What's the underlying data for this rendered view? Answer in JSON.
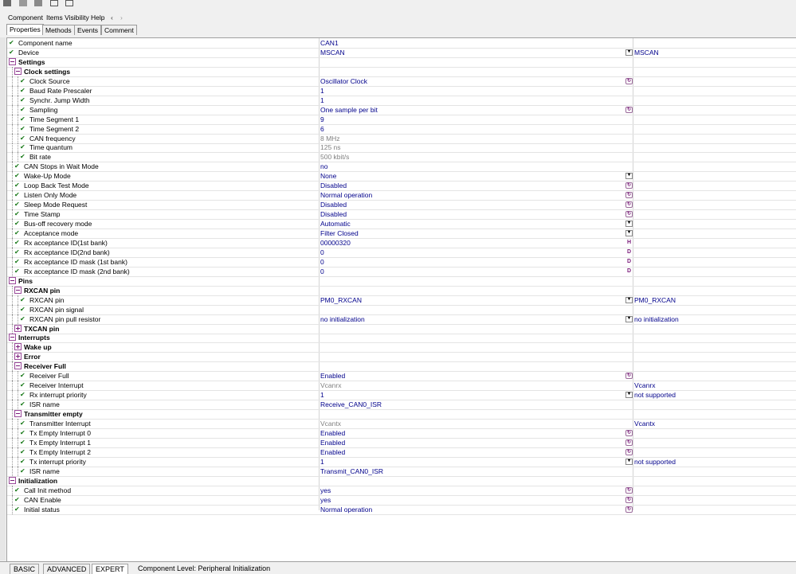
{
  "toolbar": {
    "icons": [
      "save-icon",
      "paste-icon",
      "gray-box-icon",
      "table-icon",
      "grid-icon"
    ]
  },
  "menu": {
    "component": "Component",
    "items_visibility": "Items Visibility",
    "help": "Help",
    "back": "‹",
    "forward": "›"
  },
  "tabs": [
    "Properties",
    "Methods",
    "Events",
    "Comment"
  ],
  "rows": [
    {
      "ind": 0,
      "chk": true,
      "name": "Component name",
      "val": "CAN1"
    },
    {
      "ind": 0,
      "chk": true,
      "name": "Device",
      "val": "MSCAN",
      "ctl": "dd",
      "val2": "MSCAN"
    },
    {
      "ind": 0,
      "box": "minus",
      "name": "Settings",
      "bold": true
    },
    {
      "ind": 1,
      "box": "minus",
      "name": "Clock settings",
      "bold": true
    },
    {
      "ind": 2,
      "chk": true,
      "name": "Clock Source",
      "val": "Oscillator Clock",
      "ctl": "reset"
    },
    {
      "ind": 2,
      "chk": true,
      "name": "Baud Rate Prescaler",
      "val": "1"
    },
    {
      "ind": 2,
      "chk": true,
      "name": "Synchr. Jump Width",
      "val": "1"
    },
    {
      "ind": 2,
      "chk": true,
      "name": "Sampling",
      "val": "One sample per bit",
      "ctl": "reset"
    },
    {
      "ind": 2,
      "chk": true,
      "name": "Time Segment 1",
      "val": "9"
    },
    {
      "ind": 2,
      "chk": true,
      "name": "Time Segment 2",
      "val": "6"
    },
    {
      "ind": 2,
      "chk": true,
      "name": "CAN frequency",
      "val": "8 MHz",
      "gray": true
    },
    {
      "ind": 2,
      "chk": true,
      "name": "Time quantum",
      "val": "125 ns",
      "gray": true
    },
    {
      "ind": 2,
      "chk": true,
      "name": "Bit rate",
      "val": "500 kbit/s",
      "gray": true
    },
    {
      "ind": 1,
      "chk": true,
      "name": "CAN Stops in Wait Mode",
      "val": "no"
    },
    {
      "ind": 1,
      "chk": true,
      "name": "Wake-Up Mode",
      "val": "None",
      "ctl": "dd"
    },
    {
      "ind": 1,
      "chk": true,
      "name": "Loop Back Test Mode",
      "val": "Disabled",
      "ctl": "reset"
    },
    {
      "ind": 1,
      "chk": true,
      "name": "Listen Only Mode",
      "val": "Normal operation",
      "ctl": "reset"
    },
    {
      "ind": 1,
      "chk": true,
      "name": "Sleep Mode Request",
      "val": "Disabled",
      "ctl": "reset"
    },
    {
      "ind": 1,
      "chk": true,
      "name": "Time Stamp",
      "val": "Disabled",
      "ctl": "reset"
    },
    {
      "ind": 1,
      "chk": true,
      "name": "Bus-off recovery mode",
      "val": "Automatic",
      "ctl": "dd"
    },
    {
      "ind": 1,
      "chk": true,
      "name": "Acceptance mode",
      "val": "Filter Closed",
      "ctl": "dd"
    },
    {
      "ind": 1,
      "chk": true,
      "name": "Rx acceptance ID(1st bank)",
      "val": "00000320",
      "ctl": "hex",
      "ctlText": "H"
    },
    {
      "ind": 1,
      "chk": true,
      "name": "Rx acceptance ID(2nd bank)",
      "val": "0",
      "ctl": "hex",
      "ctlText": "D"
    },
    {
      "ind": 1,
      "chk": true,
      "name": "Rx acceptance ID mask (1st bank)",
      "val": "0",
      "ctl": "hex",
      "ctlText": "D"
    },
    {
      "ind": 1,
      "chk": true,
      "name": "Rx acceptance ID mask (2nd bank)",
      "val": "0",
      "ctl": "hex",
      "ctlText": "D"
    },
    {
      "ind": 0,
      "box": "minus",
      "name": "Pins",
      "bold": true
    },
    {
      "ind": 1,
      "box": "minus",
      "name": "RXCAN pin",
      "bold": true
    },
    {
      "ind": 2,
      "chk": true,
      "name": "RXCAN pin",
      "val": "PM0_RXCAN",
      "ctl": "dd",
      "val2": "PM0_RXCAN"
    },
    {
      "ind": 2,
      "chk": true,
      "name": "RXCAN pin signal",
      "val": ""
    },
    {
      "ind": 2,
      "chk": true,
      "name": "RXCAN pin pull resistor",
      "val": "no initialization",
      "ctl": "dd",
      "val2": "no initialization"
    },
    {
      "ind": 1,
      "box": "plus",
      "name": "TXCAN pin",
      "bold": true
    },
    {
      "ind": 0,
      "box": "minus",
      "name": "Interrupts",
      "bold": true
    },
    {
      "ind": 1,
      "box": "plus",
      "name": "Wake up",
      "bold": true
    },
    {
      "ind": 1,
      "box": "plus",
      "name": "Error",
      "bold": true
    },
    {
      "ind": 1,
      "box": "minus",
      "name": "Receiver Full",
      "bold": true
    },
    {
      "ind": 2,
      "chk": true,
      "name": "Receiver Full",
      "val": "Enabled",
      "ctl": "reset"
    },
    {
      "ind": 2,
      "chk": true,
      "name": "Receiver Interrupt",
      "val": "Vcanrx",
      "gray": true,
      "val2": "Vcanrx"
    },
    {
      "ind": 2,
      "chk": true,
      "name": "Rx interrupt priority",
      "val": "1",
      "ctl": "dd",
      "val2": "not supported"
    },
    {
      "ind": 2,
      "chk": true,
      "name": "ISR name",
      "val": "Receive_CAN0_ISR"
    },
    {
      "ind": 1,
      "box": "minus",
      "name": "Transmitter empty",
      "bold": true
    },
    {
      "ind": 2,
      "chk": true,
      "name": "Transmitter Interrupt",
      "val": "Vcantx",
      "gray": true,
      "val2": "Vcantx"
    },
    {
      "ind": 2,
      "chk": true,
      "name": "Tx Empty Interrupt 0",
      "val": "Enabled",
      "ctl": "reset"
    },
    {
      "ind": 2,
      "chk": true,
      "name": "Tx Empty Interrupt 1",
      "val": "Enabled",
      "ctl": "reset"
    },
    {
      "ind": 2,
      "chk": true,
      "name": "Tx Empty Interrupt 2",
      "val": "Enabled",
      "ctl": "reset"
    },
    {
      "ind": 2,
      "chk": true,
      "name": "Tx interrupt priority",
      "val": "1",
      "ctl": "dd",
      "val2": "not supported"
    },
    {
      "ind": 2,
      "chk": true,
      "name": "ISR name",
      "val": "Transmit_CAN0_ISR"
    },
    {
      "ind": 0,
      "box": "minus",
      "name": "Initialization",
      "bold": true
    },
    {
      "ind": 1,
      "chk": true,
      "name": "Call Init method",
      "val": "yes",
      "ctl": "reset"
    },
    {
      "ind": 1,
      "chk": true,
      "name": "CAN Enable",
      "val": "yes",
      "ctl": "reset"
    },
    {
      "ind": 1,
      "chk": true,
      "name": "Initial status",
      "val": "Normal operation",
      "ctl": "reset"
    }
  ],
  "status": {
    "tabs": [
      "BASIC",
      "ADVANCED",
      "EXPERT"
    ],
    "text": "Component Level: Peripheral Initialization"
  },
  "colors": {
    "value": "#00008b",
    "check": "#1a7a1a",
    "control": "#7a1a7a",
    "gray": "#7f7f7f"
  }
}
